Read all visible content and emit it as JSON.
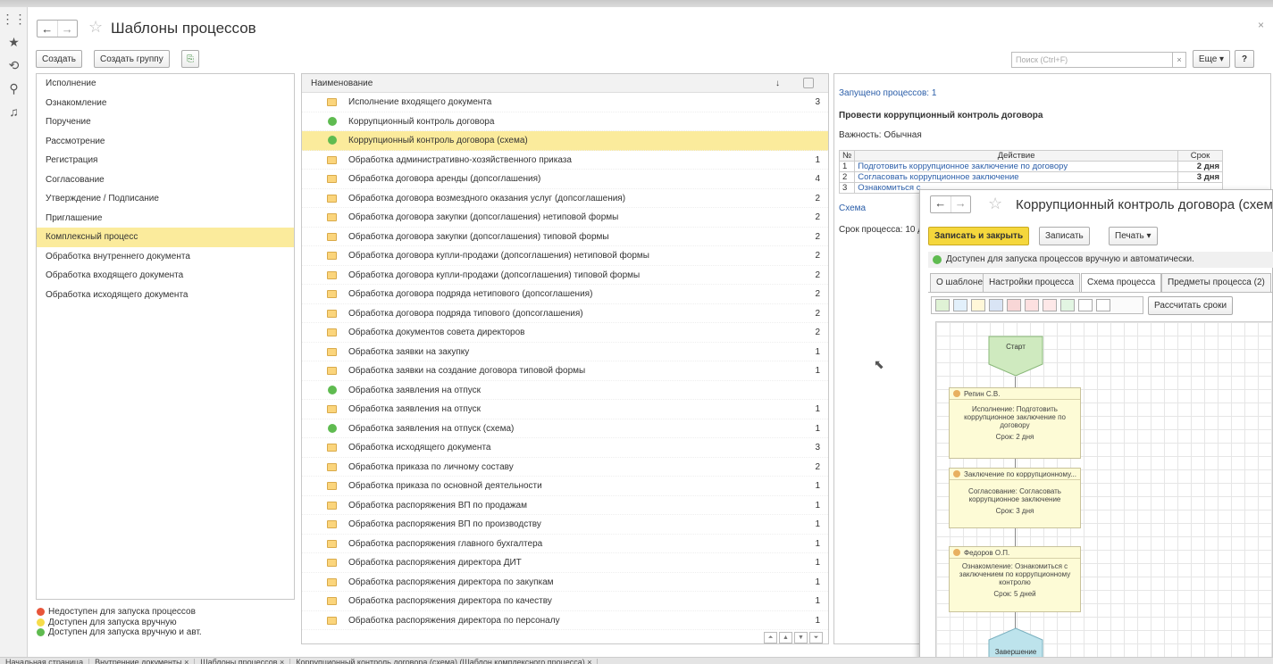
{
  "window": {
    "title": "Шаблоны процессов"
  },
  "toolbar": {
    "create": "Создать",
    "create_group": "Создать группу",
    "search_placeholder": "Поиск (Ctrl+F)",
    "search_clear": "×",
    "more": "Еще",
    "help": "?"
  },
  "groups": [
    {
      "label": "Исполнение",
      "selected": false
    },
    {
      "label": "Ознакомление",
      "selected": false
    },
    {
      "label": "Поручение",
      "selected": false
    },
    {
      "label": "Рассмотрение",
      "selected": false
    },
    {
      "label": "Регистрация",
      "selected": false
    },
    {
      "label": "Согласование",
      "selected": false
    },
    {
      "label": "Утверждение / Подписание",
      "selected": false
    },
    {
      "label": "Приглашение",
      "selected": false
    },
    {
      "label": "Комплексный процесс",
      "selected": true
    },
    {
      "label": "Обработка внутреннего документа",
      "selected": false
    },
    {
      "label": "Обработка входящего документа",
      "selected": false
    },
    {
      "label": "Обработка исходящего документа",
      "selected": false
    }
  ],
  "legend": [
    {
      "label": "Недоступен для запуска процессов",
      "color": "#e8553a"
    },
    {
      "label": "Доступен для запуска вручную",
      "color": "#f6dc4a"
    },
    {
      "label": "Доступен для запуска вручную и авт.",
      "color": "#5fbb50"
    }
  ],
  "table": {
    "header": "Наименование",
    "sort_indicator": "↓",
    "rows": [
      {
        "icon": "folder",
        "name": "Исполнение входящего документа",
        "count": "3",
        "selected": false
      },
      {
        "icon": "green",
        "name": "Коррупционный контроль договора",
        "count": "",
        "selected": false
      },
      {
        "icon": "green",
        "name": "Коррупционный контроль договора (схема)",
        "count": "",
        "selected": true
      },
      {
        "icon": "folder",
        "name": "Обработка административно-хозяйственного приказа",
        "count": "1",
        "selected": false
      },
      {
        "icon": "folder",
        "name": "Обработка договора аренды (допсоглашения)",
        "count": "4",
        "selected": false
      },
      {
        "icon": "folder",
        "name": "Обработка договора возмездного оказания услуг (допсоглашения)",
        "count": "2",
        "selected": false
      },
      {
        "icon": "folder",
        "name": "Обработка договора закупки (допсоглашения) нетиповой формы",
        "count": "2",
        "selected": false
      },
      {
        "icon": "folder",
        "name": "Обработка договора закупки (допсоглашения) типовой формы",
        "count": "2",
        "selected": false
      },
      {
        "icon": "folder",
        "name": "Обработка договора купли-продажи (допсоглашения) нетиповой формы",
        "count": "2",
        "selected": false
      },
      {
        "icon": "folder",
        "name": "Обработка договора купли-продажи (допсоглашения) типовой формы",
        "count": "2",
        "selected": false
      },
      {
        "icon": "folder",
        "name": "Обработка договора подряда нетипового (допсоглашения)",
        "count": "2",
        "selected": false
      },
      {
        "icon": "folder",
        "name": "Обработка договора подряда типового (допсоглашения)",
        "count": "2",
        "selected": false
      },
      {
        "icon": "folder",
        "name": "Обработка документов совета директоров",
        "count": "2",
        "selected": false
      },
      {
        "icon": "folder",
        "name": "Обработка заявки на закупку",
        "count": "1",
        "selected": false
      },
      {
        "icon": "folder",
        "name": "Обработка заявки на создание договора типовой формы",
        "count": "1",
        "selected": false
      },
      {
        "icon": "green",
        "name": "Обработка заявления на отпуск",
        "count": "",
        "selected": false
      },
      {
        "icon": "folder",
        "name": "Обработка заявления на отпуск",
        "count": "1",
        "selected": false
      },
      {
        "icon": "green",
        "name": "Обработка заявления на отпуск (схема)",
        "count": "1",
        "selected": false
      },
      {
        "icon": "folder",
        "name": "Обработка исходящего документа",
        "count": "3",
        "selected": false
      },
      {
        "icon": "folder",
        "name": "Обработка приказа по личному составу",
        "count": "2",
        "selected": false
      },
      {
        "icon": "folder",
        "name": "Обработка приказа по основной деятельности",
        "count": "1",
        "selected": false
      },
      {
        "icon": "folder",
        "name": "Обработка распоряжения ВП по продажам",
        "count": "1",
        "selected": false
      },
      {
        "icon": "folder",
        "name": "Обработка распоряжения ВП по производству",
        "count": "1",
        "selected": false
      },
      {
        "icon": "folder",
        "name": "Обработка распоряжения главного бухгалтера",
        "count": "1",
        "selected": false
      },
      {
        "icon": "folder",
        "name": "Обработка распоряжения директора ДИТ",
        "count": "1",
        "selected": false
      },
      {
        "icon": "folder",
        "name": "Обработка распоряжения директора по закупкам",
        "count": "1",
        "selected": false
      },
      {
        "icon": "folder",
        "name": "Обработка распоряжения директора по качеству",
        "count": "1",
        "selected": false
      },
      {
        "icon": "folder",
        "name": "Обработка распоряжения директора по персоналу",
        "count": "1",
        "selected": false
      }
    ]
  },
  "details": {
    "launched": "Запущено процессов: 1",
    "process_title": "Провести коррупционный контроль договора",
    "importance": "Важность: Обычная",
    "col_num": "№",
    "col_action": "Действие",
    "col_term": "Срок",
    "steps": [
      {
        "n": "1",
        "action": "Подготовить коррупционное заключение по договору",
        "term": "2 дня"
      },
      {
        "n": "2",
        "action": "Согласовать коррупционное заключение",
        "term": "3 дня"
      },
      {
        "n": "3",
        "action": "Ознакомиться с",
        "term": ""
      }
    ],
    "scheme_link": "Схема",
    "process_term": "Срок процесса: 10 д"
  },
  "popup": {
    "title": "Коррупционный контроль договора (схема)",
    "save_close": "Записать и закрыть",
    "save": "Записать",
    "print": "Печать",
    "status": "Доступен для запуска процессов вручную и автоматически.",
    "tabs": [
      {
        "label": "О шаблоне",
        "active": false
      },
      {
        "label": "Настройки процесса",
        "active": false
      },
      {
        "label": "Схема процесса",
        "active": true
      },
      {
        "label": "Предметы процесса (2)",
        "active": false
      }
    ],
    "calc": "Рассчитать сроки",
    "scheme": {
      "start": "Старт",
      "end": "Завершение",
      "blocks": [
        {
          "person": "Репин С.В.",
          "text": "Исполнение: Подготовить коррупционное заключение по договору",
          "term": "Срок: 2 дня"
        },
        {
          "person": "Заключение по коррупционному...",
          "text": "Согласование: Согласовать коррупционное заключение",
          "term": "Срок: 3 дня"
        },
        {
          "person": "Федоров О.П.",
          "text": "Ознакомление: Ознакомиться с заключением по коррупционному контролю",
          "term": "Срок: 5 дней"
        }
      ]
    }
  },
  "bottom_tabs": [
    "Начальная страница",
    "Внутренние документы ×",
    "Шаблоны процессов ×",
    "Коррупционный контроль договора (схема) (Шаблон комплексного процесса) ×"
  ]
}
